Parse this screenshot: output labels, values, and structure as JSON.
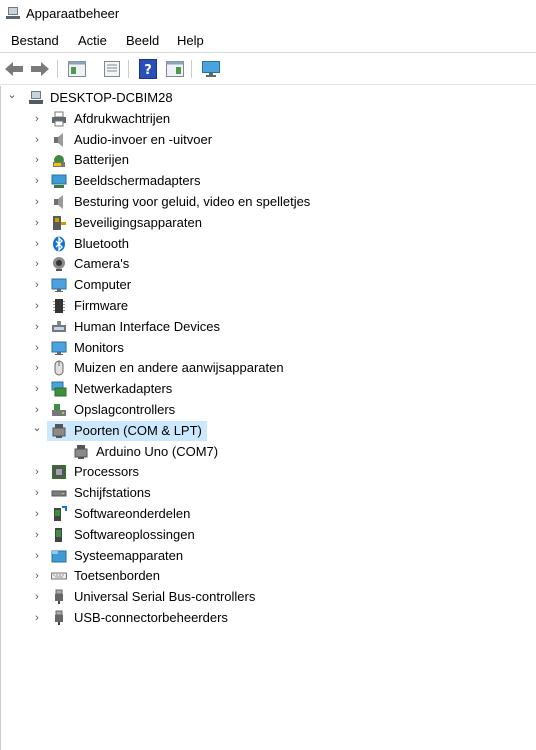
{
  "window": {
    "title": "Apparaatbeheer"
  },
  "menu": [
    "Bestand",
    "Actie",
    "Beeld",
    "Help"
  ],
  "toolbar": {
    "icons": [
      "back-arrow-icon",
      "forward-arrow-icon",
      "properties-pane-icon",
      "document-icon",
      "help-icon",
      "view-pane-icon",
      "monitor-scan-icon"
    ]
  },
  "tree": {
    "root": "DESKTOP-DCBIM28",
    "items": [
      {
        "label": "Afdrukwachtrijen",
        "icon": "printer-icon"
      },
      {
        "label": "Audio-invoer en -uitvoer",
        "icon": "speaker-icon"
      },
      {
        "label": "Batterijen",
        "icon": "battery-icon"
      },
      {
        "label": "Beeldschermadapters",
        "icon": "display-adapter-icon"
      },
      {
        "label": "Besturing voor geluid, video en spelletjes",
        "icon": "speaker-icon"
      },
      {
        "label": "Beveiligingsapparaten",
        "icon": "security-key-icon"
      },
      {
        "label": "Bluetooth",
        "icon": "bluetooth-icon"
      },
      {
        "label": "Camera's",
        "icon": "camera-icon"
      },
      {
        "label": "Computer",
        "icon": "monitor-icon"
      },
      {
        "label": "Firmware",
        "icon": "firmware-chip-icon"
      },
      {
        "label": "Human Interface Devices",
        "icon": "hid-icon"
      },
      {
        "label": "Monitors",
        "icon": "monitor-icon"
      },
      {
        "label": "Muizen en andere aanwijsapparaten",
        "icon": "mouse-icon"
      },
      {
        "label": "Netwerkadapters",
        "icon": "network-icon"
      },
      {
        "label": "Opslagcontrollers",
        "icon": "storage-controller-icon"
      },
      {
        "label": "Poorten (COM & LPT)",
        "icon": "port-icon",
        "expanded": true,
        "selected": true,
        "children": [
          {
            "label": "Arduino Uno (COM7)",
            "icon": "port-icon"
          }
        ]
      },
      {
        "label": "Processors",
        "icon": "processor-icon"
      },
      {
        "label": "Schijfstations",
        "icon": "disk-drive-icon"
      },
      {
        "label": "Softwareonderdelen",
        "icon": "software-component-icon"
      },
      {
        "label": "Softwareoplossingen",
        "icon": "software-device-icon"
      },
      {
        "label": "Systeemapparaten",
        "icon": "system-folder-icon"
      },
      {
        "label": "Toetsenborden",
        "icon": "keyboard-icon"
      },
      {
        "label": "Universal Serial Bus-controllers",
        "icon": "usb-icon"
      },
      {
        "label": "USB-connectorbeheerders",
        "icon": "usb-icon"
      }
    ]
  },
  "colors": {
    "selection": "#cce8ff",
    "accent": "#0078d7"
  }
}
